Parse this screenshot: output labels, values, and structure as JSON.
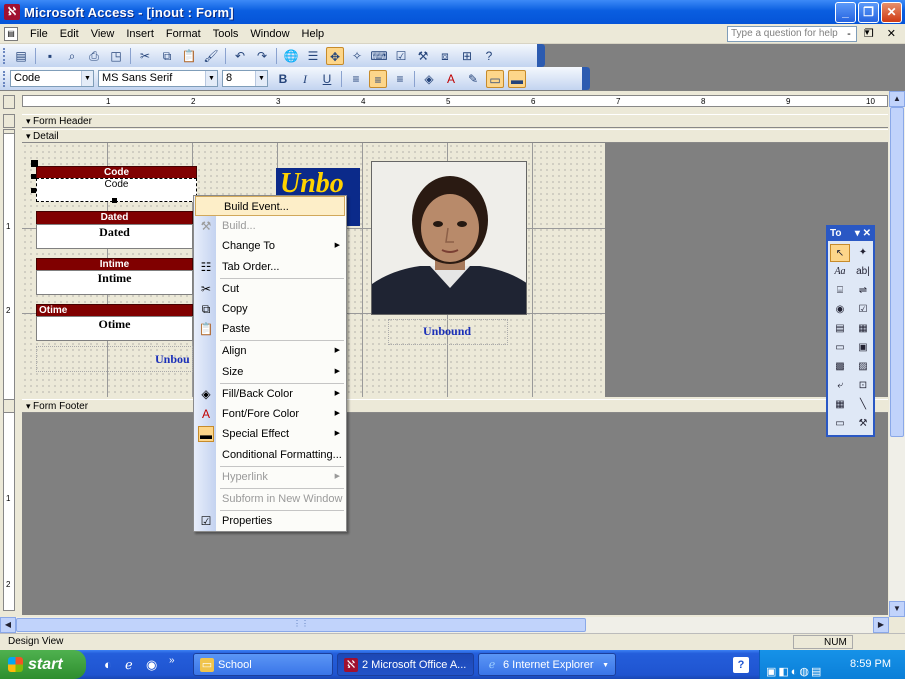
{
  "window": {
    "title": "Microsoft Access - [inout : Form]",
    "min_glyph": "_",
    "max_glyph": "❐",
    "close_glyph": "✕"
  },
  "menubar": {
    "items": [
      "File",
      "Edit",
      "View",
      "Insert",
      "Format",
      "Tools",
      "Window",
      "Help"
    ],
    "question_placeholder": "Type a question for help",
    "mdi_controls": "- ❐ ✕"
  },
  "format_toolbar": {
    "object_combo": "Code",
    "font_combo": "MS Sans Serif",
    "size_combo": "8",
    "bold": "B",
    "italic": "I",
    "underline": "U"
  },
  "ruler": {
    "h_marks": [
      "1",
      "2",
      "3",
      "4",
      "5",
      "6",
      "7",
      "8",
      "9",
      "10"
    ],
    "v_marks": [
      "1",
      "2",
      "1",
      "2"
    ]
  },
  "sections": {
    "form_header": "Form Header",
    "detail": "Detail",
    "form_footer": "Form Footer"
  },
  "form_controls": {
    "code_label": "Code",
    "code_field": "Code",
    "dated_label": "Dated",
    "dated_field": "Dated",
    "intime_label": "Intime",
    "intime_field": "Intime",
    "otime_label": "Otime",
    "otime_field": "Otime",
    "unbound_partial": "Unbou",
    "unbound_image_text": "Unbo",
    "photo_caption": "Unbound"
  },
  "context_menu": {
    "items": [
      {
        "label": "Build Event...",
        "state": "highlighted"
      },
      {
        "label": "Build...",
        "state": "disabled"
      },
      {
        "label": "Change To",
        "submenu": true
      },
      {
        "label": "Tab Order..."
      },
      {
        "label": "Cut"
      },
      {
        "label": "Copy"
      },
      {
        "label": "Paste"
      },
      {
        "label": "Align",
        "submenu": true
      },
      {
        "label": "Size",
        "submenu": true
      },
      {
        "label": "Fill/Back Color",
        "submenu": true
      },
      {
        "label": "Font/Fore Color",
        "submenu": true
      },
      {
        "label": "Special Effect",
        "submenu": true
      },
      {
        "label": "Conditional Formatting..."
      },
      {
        "label": "Hyperlink",
        "state": "disabled",
        "submenu": true
      },
      {
        "label": "Subform in New Window",
        "state": "disabled"
      },
      {
        "label": "Properties"
      }
    ]
  },
  "toolbox": {
    "title": "To",
    "title_controls": "▾ ✕",
    "tools": [
      "pointer-icon",
      "wizard-icon",
      "label-icon",
      "textbox-icon",
      "option-group-icon",
      "toggle-icon",
      "option-button-icon",
      "checkbox-icon",
      "combo-icon",
      "listbox-icon",
      "command-icon",
      "image-icon",
      "unbound-frame-icon",
      "bound-frame-icon",
      "page-break-icon",
      "tab-control-icon",
      "subform-icon",
      "line-icon",
      "rectangle-icon",
      "more-controls-icon"
    ]
  },
  "statusbar": {
    "mode": "Design View",
    "num": "NUM"
  },
  "taskbar": {
    "start_label": "start",
    "tasks": [
      {
        "label": "School"
      },
      {
        "label": "2 Microsoft Office A..."
      },
      {
        "label": "6 Internet Explorer"
      }
    ],
    "clock": "8:59 PM"
  }
}
